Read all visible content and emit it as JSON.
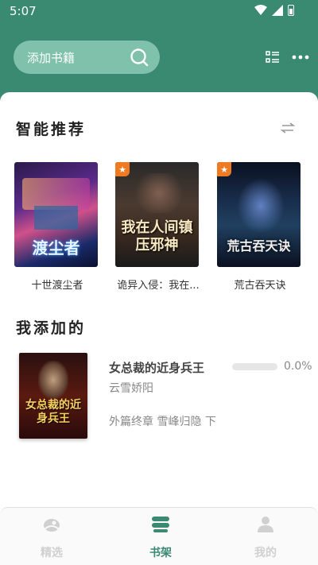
{
  "status_bar": {
    "time": "5:07"
  },
  "header": {
    "search_placeholder": "添加书籍",
    "icons": [
      "search-icon",
      "list-icon",
      "more-icon"
    ]
  },
  "recommend": {
    "title": "智能推荐",
    "books": [
      {
        "title": "十世渡尘者",
        "cover_text": "渡尘者",
        "badge": false
      },
      {
        "title": "诡异入侵：我在...",
        "cover_text": "我在人间镇压邪神",
        "badge": true
      },
      {
        "title": "荒古吞天诀",
        "cover_text": "荒古吞天诀",
        "badge": true
      }
    ]
  },
  "added": {
    "title": "我添加的",
    "book": {
      "title": "女总裁的近身兵王",
      "author": "云雪娇阳",
      "chapter": "外篇终章 雪峰归隐 下",
      "progress_text": "0.0%",
      "progress": 0.0,
      "cover_text": "女总裁的近身兵王"
    }
  },
  "nav": {
    "items": [
      {
        "label": "精选",
        "active": false
      },
      {
        "label": "书架",
        "active": true
      },
      {
        "label": "我的",
        "active": false
      }
    ]
  },
  "colors": {
    "primary": "#3a8a72",
    "search_bg": "#7fc1ab",
    "badge": "#f07a22"
  }
}
